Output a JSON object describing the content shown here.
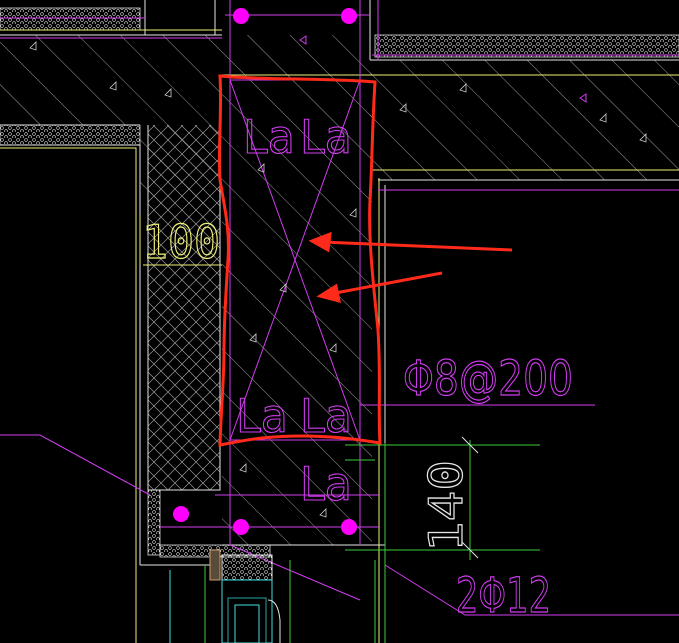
{
  "drawing": {
    "labels": {
      "dim_100": "100",
      "rebar_spacing": "Φ8@200",
      "dim_140": "140",
      "rebar_main": "2Φ12",
      "anchor_1": "La",
      "anchor_2": "La",
      "anchor_3": "La",
      "anchor_4": "La",
      "anchor_5": "La"
    },
    "colors": {
      "background": "#000000",
      "magenta": "#d23cf0",
      "white": "#e6e6e6",
      "yellow": "#f0f07a",
      "green": "#3ccc3c",
      "red": "#ff2a1a",
      "rebar_dot": "#ff00ff",
      "cyan": "#40e0e0",
      "teal": "#2aa8a8"
    }
  }
}
